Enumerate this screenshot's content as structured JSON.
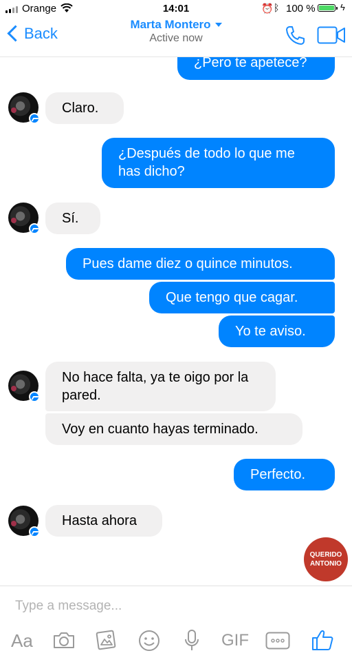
{
  "status_bar": {
    "carrier": "Orange",
    "time": "14:01",
    "battery": "100 %"
  },
  "header": {
    "back_label": "Back",
    "contact_name": "Marta Montero",
    "status": "Active now"
  },
  "messages": [
    {
      "sender": "me",
      "text": "¿Pero te apetece?"
    },
    {
      "sender": "them",
      "text": "Claro."
    },
    {
      "sender": "me",
      "text": "¿Después de todo lo que me has dicho?"
    },
    {
      "sender": "them",
      "text": "Sí."
    },
    {
      "sender": "me",
      "text": "Pues dame diez o quince minutos."
    },
    {
      "sender": "me",
      "text": "Que tengo que cagar."
    },
    {
      "sender": "me",
      "text": "Yo te aviso."
    },
    {
      "sender": "them",
      "text": "No hace falta, ya te oigo por la pared."
    },
    {
      "sender": "them",
      "text": "Voy en cuanto hayas terminado."
    },
    {
      "sender": "me",
      "text": "Perfecto."
    },
    {
      "sender": "them",
      "text": "Hasta ahora"
    }
  ],
  "watermark": "QUERIDO ANTONIO",
  "composer": {
    "placeholder": "Type a message...",
    "aa_label": "Aa",
    "gif_label": "GIF",
    "icons": [
      "aa-icon",
      "camera-icon",
      "gallery-icon",
      "emoji-icon",
      "microphone-icon",
      "gif-icon",
      "more-icon",
      "like-icon"
    ]
  },
  "colors": {
    "accent": "#1a8cff",
    "outgoing_bubble": "#0084ff",
    "incoming_bubble": "#f1f0f0",
    "watermark": "#c0392b"
  }
}
